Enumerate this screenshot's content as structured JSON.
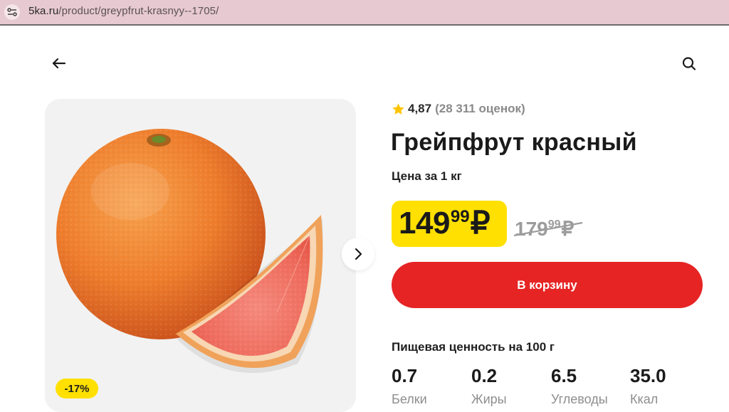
{
  "browser": {
    "url_domain": "5ka.ru",
    "url_path": "/product/greypfrut-krasnyy--1705/"
  },
  "nav": {
    "back_icon": "arrow-left-icon",
    "search_icon": "search-icon"
  },
  "product": {
    "image_name": "grapefruit-photo",
    "discount_badge": "-17%",
    "rating_value": "4,87",
    "rating_count": "(28 311 оценок)",
    "title": "Грейпфрут красный",
    "price_unit": "Цена за 1 кг",
    "price": {
      "integer": "149",
      "fraction": "99",
      "currency": "₽"
    },
    "old_price": {
      "integer": "179",
      "fraction": "99",
      "currency": "₽"
    },
    "add_to_cart_label": "В корзину"
  },
  "nutrition": {
    "title": "Пищевая ценность на 100 г",
    "items": [
      {
        "value": "0.7",
        "label": "Белки"
      },
      {
        "value": "0.2",
        "label": "Жиры"
      },
      {
        "value": "6.5",
        "label": "Углеводы"
      },
      {
        "value": "35.0",
        "label": "Ккал"
      }
    ]
  },
  "colors": {
    "accent_yellow": "#ffe000",
    "cart_red": "#e62424",
    "muted_gray": "#8a8a8a"
  }
}
